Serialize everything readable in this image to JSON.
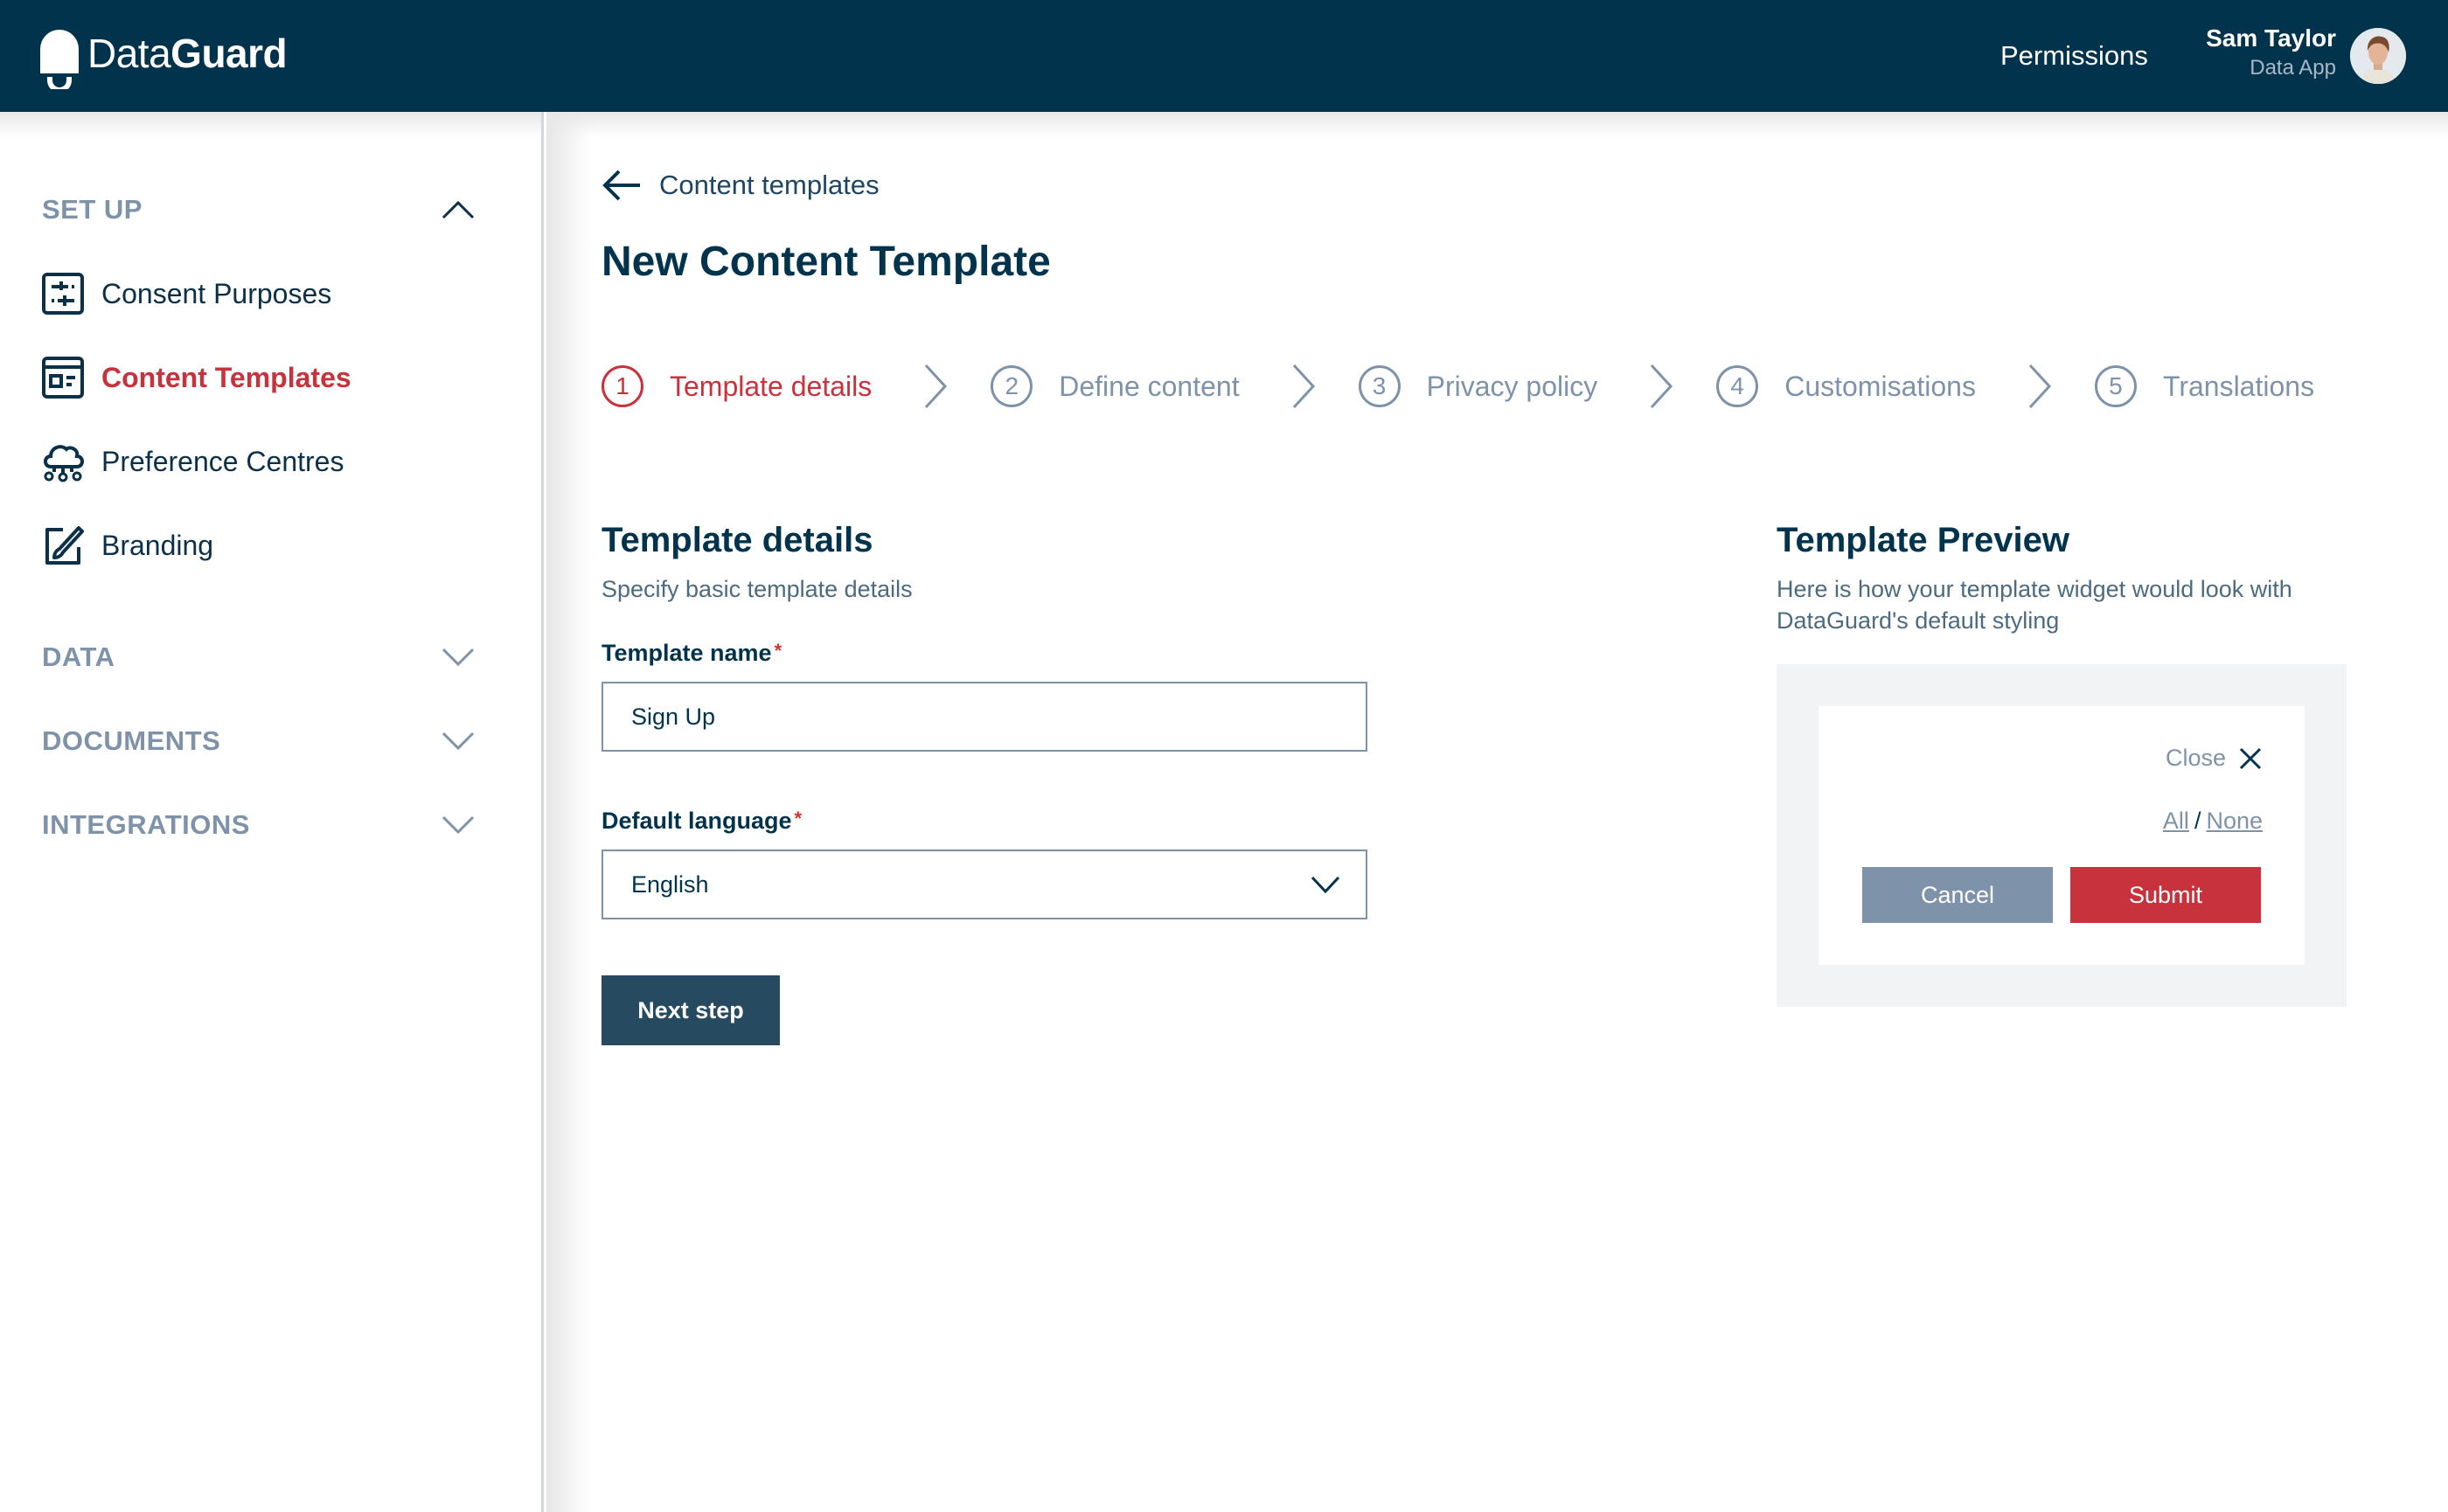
{
  "header": {
    "brand_light": "Data",
    "brand_bold": "Guard",
    "nav_permissions": "Permissions",
    "user_name": "Sam Taylor",
    "user_role": "Data App"
  },
  "sidebar": {
    "sections": [
      {
        "label": "SET UP",
        "expanded": true
      },
      {
        "label": "DATA",
        "expanded": false
      },
      {
        "label": "DOCUMENTS",
        "expanded": false
      },
      {
        "label": "INTEGRATIONS",
        "expanded": false
      }
    ],
    "items": [
      {
        "label": "Consent Purposes",
        "icon": "sliders-icon",
        "active": false
      },
      {
        "label": "Content Templates",
        "icon": "template-icon",
        "active": true
      },
      {
        "label": "Preference Centres",
        "icon": "cloud-network-icon",
        "active": false
      },
      {
        "label": "Branding",
        "icon": "edit-brush-icon",
        "active": false
      }
    ]
  },
  "main": {
    "back_label": "Content templates",
    "title": "New Content Template",
    "steps": [
      {
        "num": "1",
        "label": "Template details",
        "active": true
      },
      {
        "num": "2",
        "label": "Define content",
        "active": false
      },
      {
        "num": "3",
        "label": "Privacy policy",
        "active": false
      },
      {
        "num": "4",
        "label": "Customisations",
        "active": false
      },
      {
        "num": "5",
        "label": "Translations",
        "active": false
      }
    ],
    "form": {
      "title": "Template details",
      "subtitle": "Specify basic template details",
      "name_label": "Template name",
      "name_value": "Sign Up",
      "required_mark": "*",
      "language_label": "Default language",
      "language_value": "English",
      "next_label": "Next step"
    },
    "preview": {
      "title": "Template Preview",
      "description_line1": "Here is how your template widget would look with",
      "description_line2": "DataGuard's default styling",
      "close_label": "Close",
      "all_label": "All",
      "slash": "/",
      "none_label": "None",
      "cancel_label": "Cancel",
      "submit_label": "Submit"
    }
  },
  "colors": {
    "header_bg": "#01334c",
    "accent_red": "#c8323c",
    "muted": "#7e93a9",
    "primary_button": "#264a5f"
  }
}
